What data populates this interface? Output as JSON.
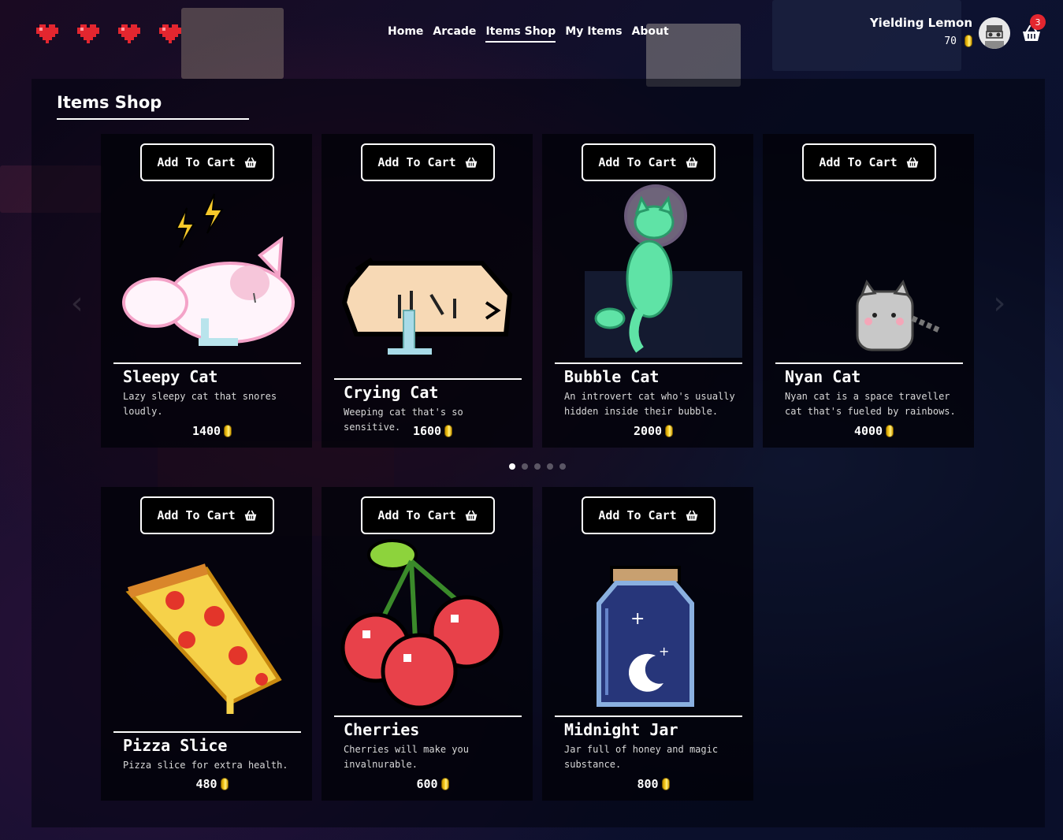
{
  "header": {
    "hearts": 4,
    "nav": [
      "Home",
      "Arcade",
      "Items Shop",
      "My Items",
      "About"
    ],
    "active_nav": "Items Shop",
    "user": {
      "name": "Yielding Lemon",
      "balance": "70"
    },
    "cart_count": "3"
  },
  "page": {
    "title": "Items Shop"
  },
  "carousel": {
    "items": [
      {
        "name": "Sleepy Cat",
        "description": "Lazy sleepy cat that snores loudly.",
        "price": "1400",
        "button": "Add To Cart",
        "icon": "sleepy-cat-icon"
      },
      {
        "name": "Crying Cat",
        "description": "Weeping cat that's so sensitive.",
        "price": "1600",
        "button": "Add To Cart",
        "icon": "crying-cat-icon"
      },
      {
        "name": "Bubble Cat",
        "description": "An introvert cat who's usually hidden inside their bubble.",
        "price": "2000",
        "button": "Add To Cart",
        "icon": "bubble-cat-icon"
      },
      {
        "name": "Nyan Cat",
        "description": "Nyan cat is a space traveller cat that's fueled by rainbows.",
        "price": "4000",
        "button": "Add To Cart",
        "icon": "nyan-cat-icon"
      }
    ],
    "dots": 5,
    "active_dot": 0
  },
  "grid": {
    "items": [
      {
        "name": "Pizza Slice",
        "description": "Pizza slice for extra health.",
        "price": "480",
        "button": "Add To Cart",
        "icon": "pizza-slice-icon"
      },
      {
        "name": "Cherries",
        "description": "Cherries will make you invalnurable.",
        "price": "600",
        "button": "Add To Cart",
        "icon": "cherries-icon"
      },
      {
        "name": "Midnight Jar",
        "description": "Jar full of honey and magic substance.",
        "price": "800",
        "button": "Add To Cart",
        "icon": "midnight-jar-icon"
      }
    ]
  },
  "colors": {
    "heart": "#e3262f",
    "badge": "#e3262f",
    "coin": "#ffd62a"
  }
}
